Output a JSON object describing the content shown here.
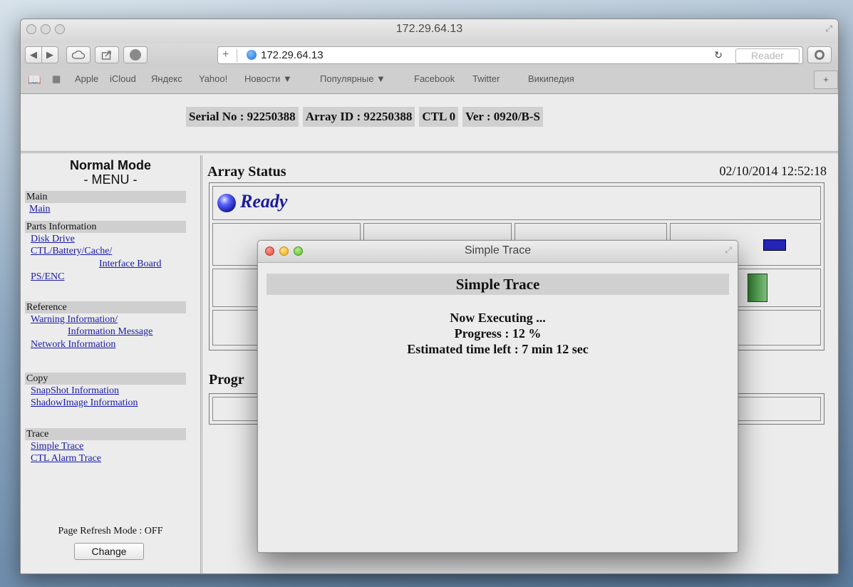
{
  "browser": {
    "window_title": "172.29.64.13",
    "address": "172.29.64.13",
    "reader_label": "Reader",
    "bookmarks": [
      "Apple",
      "iCloud",
      "Яндекс",
      "Yahoo!",
      "Новости ▼",
      "Популярные ▼",
      "Facebook",
      "Twitter",
      "Википедия"
    ]
  },
  "header": {
    "serial": "Serial No : 92250388",
    "array_id": "Array ID : 92250388",
    "ctl": "CTL 0",
    "ver": "Ver : 0920/B-S"
  },
  "sidebar": {
    "mode": "Normal Mode",
    "menu": "- MENU -",
    "sections": {
      "main": "Main",
      "parts": "Parts Information",
      "reference": "Reference",
      "copy": "Copy",
      "trace": "Trace"
    },
    "links": {
      "main": "Main",
      "disk_drive": "Disk Drive",
      "ctl_battery": "CTL/Battery/Cache/",
      "interface_board": "Interface Board",
      "ps_enc": "PS/ENC",
      "warning_info": "Warning Information/",
      "info_message": "Information Message",
      "network_info": "Network Information",
      "snapshot_info": "SnapShot Information",
      "shadowimage_info": "ShadowImage Information",
      "simple_trace": "Simple Trace",
      "ctl_alarm_trace": "CTL Alarm Trace"
    },
    "refresh_mode": "Page Refresh Mode : OFF",
    "change_button": "Change"
  },
  "main": {
    "array_status": "Array Status",
    "timestamp": "02/10/2014 12:52:18",
    "status": "Ready",
    "progress_label": "Progr"
  },
  "dialog": {
    "window_title": "Simple Trace",
    "header": "Simple Trace",
    "executing": "Now Executing ...",
    "progress_text": "Progress : 12 %",
    "progress_percent": 12,
    "time_left": "Estimated time left : 7 min 12 sec"
  }
}
